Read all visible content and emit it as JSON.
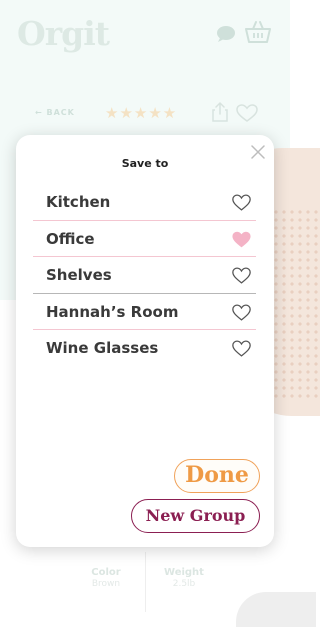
{
  "app": {
    "logo_text": "Orgit"
  },
  "header": {
    "chat_icon": "chat-bubble-icon",
    "cart_icon": "basket-icon"
  },
  "product": {
    "back_label": "BACK",
    "rating": 4.5,
    "rating_stars": "★★★★★",
    "specs": [
      {
        "label": "Color",
        "value": "Brown"
      },
      {
        "label": "Weight",
        "value": "2.5lb"
      }
    ]
  },
  "modal": {
    "title": "Save to",
    "close_icon": "close-icon",
    "groups": [
      {
        "label": "Kitchen",
        "saved": false
      },
      {
        "label": "Office",
        "saved": true
      },
      {
        "label": "Shelves",
        "saved": false
      },
      {
        "label": "Hannah’s Room",
        "saved": false
      },
      {
        "label": "Wine Glasses",
        "saved": false
      }
    ],
    "done_label": "Done",
    "new_group_label": "New Group"
  },
  "colors": {
    "accent_orange": "#ef9a45",
    "accent_maroon": "#8b1f52",
    "heart_selected": "#f4b3c6",
    "heart_outline": "#555555"
  }
}
